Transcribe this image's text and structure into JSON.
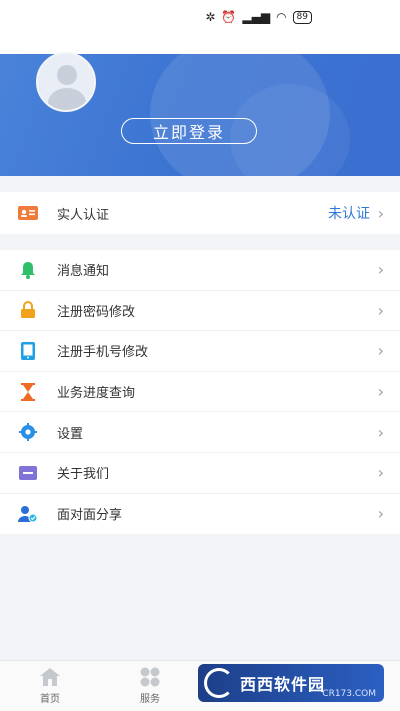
{
  "status_bar": {
    "battery": "89"
  },
  "profile": {
    "login_label": "立即登录"
  },
  "verify": {
    "label": "实人认证",
    "status": "未认证"
  },
  "menu": {
    "items": [
      {
        "label": "消息通知",
        "icon": "bell-icon",
        "color": "#2fbf6b"
      },
      {
        "label": "注册密码修改",
        "icon": "lock-icon",
        "color": "#f2a21a"
      },
      {
        "label": "注册手机号修改",
        "icon": "phone-icon",
        "color": "#1ea0e6"
      },
      {
        "label": "业务进度查询",
        "icon": "hourglass-icon",
        "color": "#f06b2a"
      },
      {
        "label": "设置",
        "icon": "gear-icon",
        "color": "#2a8fe6"
      },
      {
        "label": "关于我们",
        "icon": "info-card-icon",
        "color": "#7f73d8"
      },
      {
        "label": "面对面分享",
        "icon": "share-user-icon",
        "color": "#2a6fd8"
      }
    ]
  },
  "tabbar": {
    "tabs": [
      {
        "label": "首页",
        "icon": "home-icon"
      },
      {
        "label": "服务",
        "icon": "grid-icon"
      }
    ]
  },
  "watermark": {
    "text": "西西软件园",
    "sub": "CR173.COM"
  }
}
